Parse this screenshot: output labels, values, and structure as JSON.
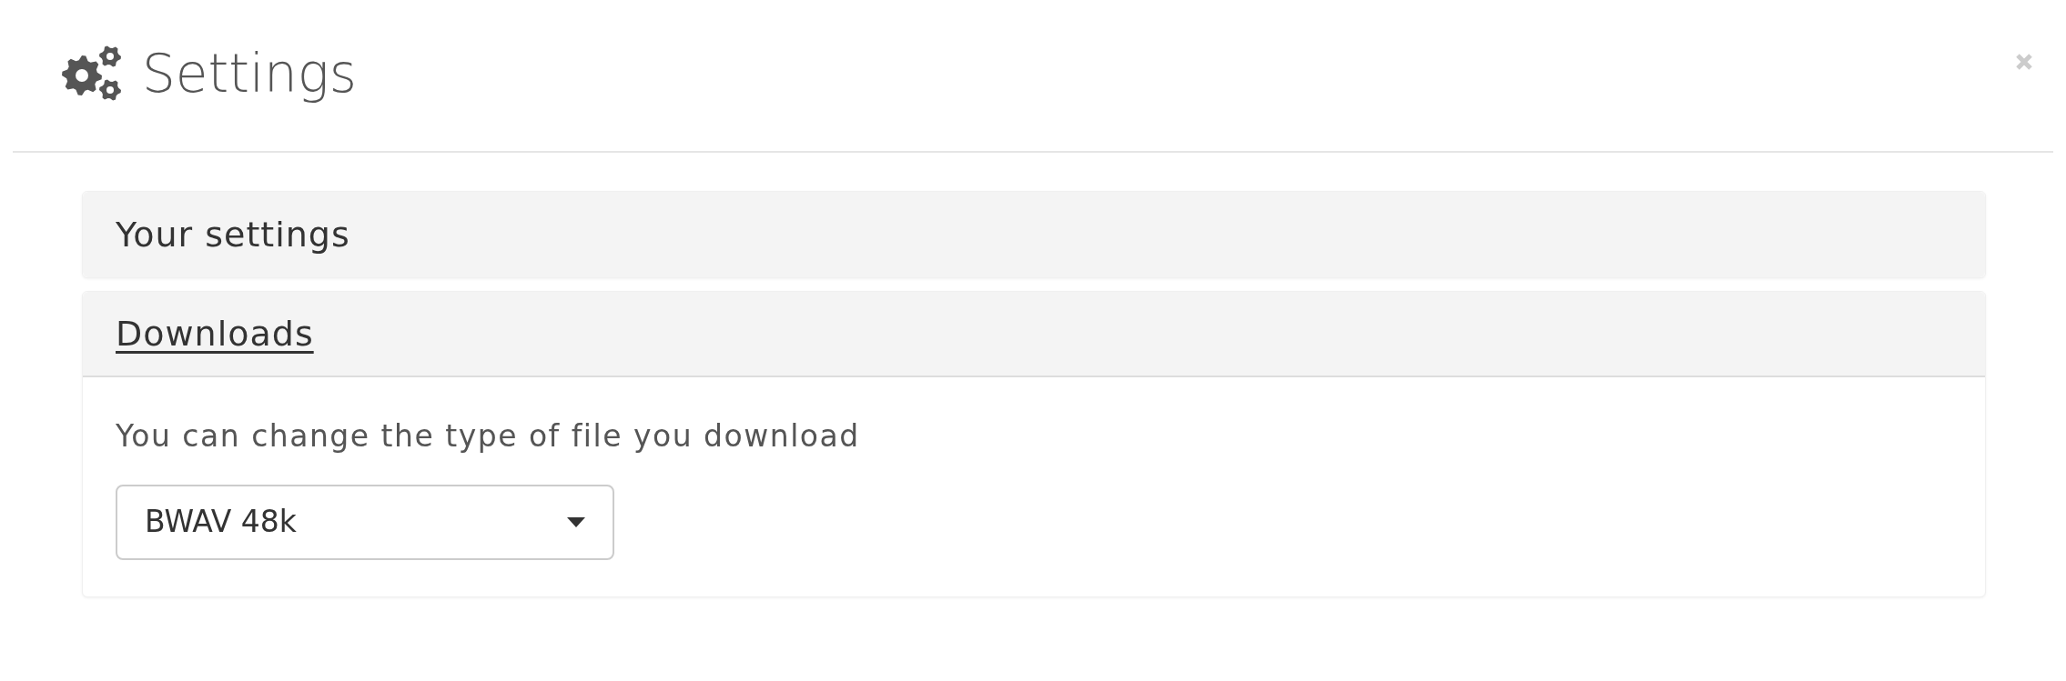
{
  "dialog": {
    "title": "Settings"
  },
  "panels": [
    {
      "title": "Your settings",
      "expanded": false,
      "focused": false
    },
    {
      "title": "Downloads",
      "expanded": true,
      "focused": true,
      "description": "You can change the type of file you download",
      "select": {
        "value": "BWAV 48k"
      }
    }
  ]
}
